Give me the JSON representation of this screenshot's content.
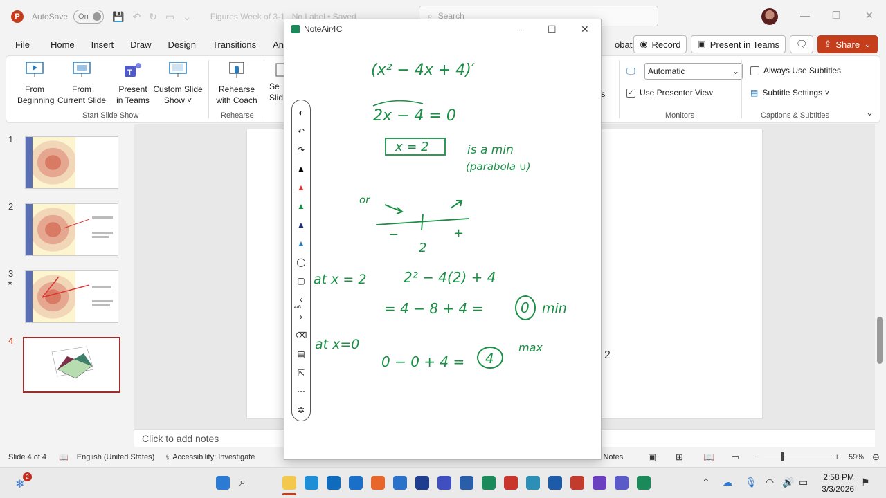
{
  "titlebar": {
    "autosave_label": "AutoSave",
    "autosave_state": "On",
    "doc_title": "Figures Week of 3-1",
    "label_status": "No Label • Saved",
    "search_placeholder": "Search"
  },
  "menu": {
    "items": [
      "File",
      "Home",
      "Insert",
      "Draw",
      "Design",
      "Transitions",
      "Animat",
      "obat"
    ],
    "record_label": "Record",
    "present_teams_label": "Present in Teams",
    "share_label": "Share"
  },
  "ribbon": {
    "from_beginning": [
      "From",
      "Beginning"
    ],
    "from_current": [
      "From",
      "Current Slide"
    ],
    "present_teams": [
      "Present",
      "in Teams"
    ],
    "custom_show": [
      "Custom Slide",
      "Show ˅"
    ],
    "rehearse": [
      "Rehearse",
      "with Coach"
    ],
    "partial_slide": [
      "Se",
      "Slid"
    ],
    "partial_tools": "ols",
    "group_start": "Start Slide Show",
    "group_rehearse": "Rehearse",
    "group_monitors": "Monitors",
    "group_captions": "Captions & Subtitles",
    "monitor_select": "Automatic",
    "presenter_view": "Use Presenter View",
    "always_subtitles": "Always Use Subtitles",
    "subtitle_settings": "Subtitle Settings ˅"
  },
  "thumbnails": [
    "1",
    "2",
    "3",
    "4"
  ],
  "notes_placeholder": "Click to add notes",
  "slide_fragment": "2",
  "status": {
    "slide_count": "Slide 4 of 4",
    "language": "English (United States)",
    "accessibility": "Accessibility: Investigate",
    "notes": "Notes",
    "zoom": "59%"
  },
  "noteair": {
    "title": "NoteAir4C",
    "page_indicator": "4/6",
    "ink_lines": {
      "l1": "(x² − 4x + 4)′",
      "l2": "2x − 4 = 0",
      "l3": "x = 2",
      "l4": "is a min",
      "l5": "(parabola ∪)",
      "or": "or",
      "minus": "−",
      "plus": "+",
      "two": "2",
      "atx2": "at x = 2",
      "eval2": "2² − 4(2) + 4",
      "res2a": "= 4 − 8 + 4 =",
      "res2b": "0",
      "min": "min",
      "atx0": "at x=0",
      "res0a": "0 − 0 + 4 =",
      "res0b": "4",
      "max": "max"
    }
  },
  "taskbar": {
    "time": "2:58 PM",
    "date": "3/3/2026",
    "badge": "2"
  },
  "colors": {
    "accent": "#c43e1c",
    "ink": "#1a8f45"
  }
}
